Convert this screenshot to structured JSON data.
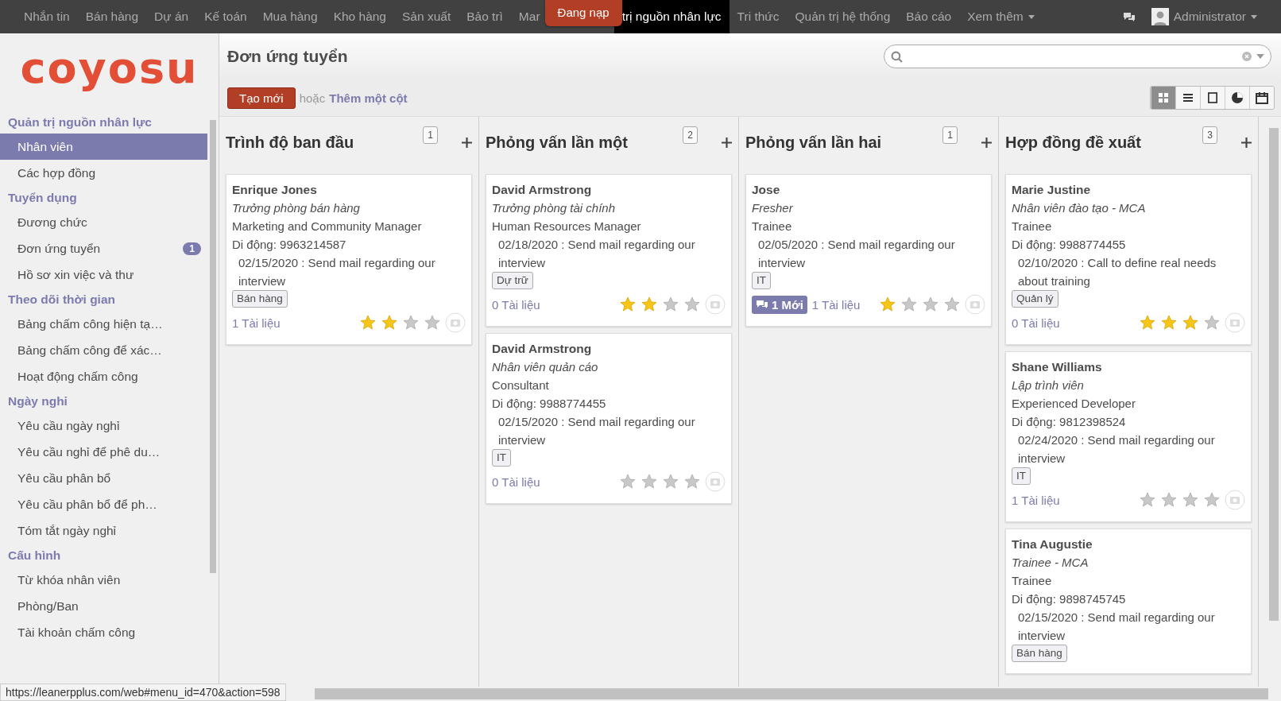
{
  "topbar": {
    "menu": [
      {
        "label": "Nhắn tin",
        "selected": false
      },
      {
        "label": "Bán hàng",
        "selected": false
      },
      {
        "label": "Dự án",
        "selected": false
      },
      {
        "label": "Kế toán",
        "selected": false
      },
      {
        "label": "Mua hàng",
        "selected": false
      },
      {
        "label": "Kho hàng",
        "selected": false
      },
      {
        "label": "Sản xuất",
        "selected": false
      },
      {
        "label": "Bảo trì",
        "selected": false
      },
      {
        "label": "Mar",
        "selected": false
      },
      {
        "label": "trị nguồn nhân lực",
        "selected": true
      },
      {
        "label": "Tri thức",
        "selected": false
      },
      {
        "label": "Quản trị hệ thống",
        "selected": false
      },
      {
        "label": "Báo cáo",
        "selected": false
      },
      {
        "label": "Xem thêm",
        "selected": false
      }
    ],
    "loading": "Đang nạp",
    "user": "Administrator"
  },
  "sidebar": {
    "logo": "coyosu",
    "sections": [
      {
        "title": "Quản trị nguồn nhân lực",
        "items": [
          {
            "label": "Nhân viên",
            "selected": true
          },
          {
            "label": "Các hợp đồng",
            "selected": false
          }
        ]
      },
      {
        "title": "Tuyển dụng",
        "items": [
          {
            "label": "Đương chức",
            "selected": false
          },
          {
            "label": "Đơn ứng tuyển",
            "selected": false,
            "badge": "1"
          },
          {
            "label": "Hồ sơ xin việc và thư",
            "selected": false
          }
        ]
      },
      {
        "title": "Theo dõi thời gian",
        "items": [
          {
            "label": "Bảng chấm công hiện tạ…",
            "selected": false
          },
          {
            "label": "Bảng chấm công để xác…",
            "selected": false
          },
          {
            "label": "Hoạt động chấm công",
            "selected": false
          }
        ]
      },
      {
        "title": "Ngày nghỉ",
        "items": [
          {
            "label": "Yêu cầu ngày nghỉ",
            "selected": false
          },
          {
            "label": "Yêu cầu nghỉ để phê du…",
            "selected": false
          },
          {
            "label": "Yêu cầu phân bổ",
            "selected": false
          },
          {
            "label": "Yêu cầu phân bổ để ph…",
            "selected": false
          },
          {
            "label": "Tóm tắt ngày nghỉ",
            "selected": false
          }
        ]
      },
      {
        "title": "Cấu hình",
        "items": [
          {
            "label": "Từ khóa nhân viên",
            "selected": false
          },
          {
            "label": "Phòng/Ban",
            "selected": false
          },
          {
            "label": "Tài khoản chấm công",
            "selected": false
          }
        ]
      }
    ]
  },
  "page": {
    "title": "Đơn ứng tuyển",
    "create_button": "Tạo mới",
    "or": "hoặc",
    "add_column": "Thêm một cột",
    "views": [
      {
        "kind": "kanban",
        "selected": true
      },
      {
        "kind": "list",
        "selected": false
      },
      {
        "kind": "form",
        "selected": false
      },
      {
        "kind": "graph",
        "selected": false
      },
      {
        "kind": "calendar",
        "selected": false
      }
    ]
  },
  "columns": [
    {
      "title": "Trình độ ban đầu",
      "count": "1",
      "cards": [
        {
          "name": "Enrique Jones",
          "position": "Trưởng phòng bán hàng",
          "job": "Marketing and Community Manager",
          "phone": "Di động: 9963214587",
          "activity": "02/15/2020 : Send mail regarding our interview",
          "tag": "Bán hàng",
          "documents": "1 Tài liệu",
          "stars": 2
        }
      ]
    },
    {
      "title": "Phỏng vấn lần một",
      "count": "2",
      "cards": [
        {
          "name": "David Armstrong",
          "position": "Trưởng phòng tài chính",
          "job": "Human Resources Manager",
          "activity": "02/18/2020 : Send mail regarding our interview",
          "tag": "Dự trữ",
          "documents": "0 Tài liệu",
          "stars": 2
        },
        {
          "name": "David Armstrong",
          "position": "Nhân viên quản cáo",
          "job": "Consultant",
          "phone": "Di động: 9988774455",
          "activity": "02/15/2020 : Send mail regarding our interview",
          "tag": "IT",
          "documents": "0 Tài liệu",
          "stars": 0
        }
      ]
    },
    {
      "title": "Phỏng vấn lần hai",
      "count": "1",
      "cards": [
        {
          "name": "Jose",
          "position": "Fresher",
          "job": "Trainee",
          "activity": "02/05/2020 : Send mail regarding our interview",
          "tag": "IT",
          "messages": "1 Mới",
          "documents": "1 Tài liệu",
          "stars": 1
        }
      ]
    },
    {
      "title": "Hợp đồng đề xuất",
      "count": "3",
      "cards": [
        {
          "name": "Marie Justine",
          "position": "Nhân viên đào tạo - MCA",
          "job": "Trainee",
          "phone": "Di động: 9988774455",
          "activity": "02/10/2020 : Call to define real needs about training",
          "tag": "Quản lý",
          "documents": "0 Tài liệu",
          "stars": 3
        },
        {
          "name": "Shane Williams",
          "position": "Lập trình viên",
          "job": "Experienced Developer",
          "phone": "Di động: 9812398524",
          "activity": "02/24/2020 : Send mail regarding our interview",
          "tag": "IT",
          "documents": "1 Tài liệu",
          "stars": 0
        },
        {
          "name": "Tina Augustie",
          "position": "Trainee - MCA",
          "job": "Trainee",
          "phone": "Di động: 9898745745",
          "activity": "02/15/2020 : Send mail regarding our interview",
          "tag": "Bán hàng"
        }
      ]
    }
  ],
  "status_url": "https://leanerpplus.com/web#menu_id=470&action=598"
}
